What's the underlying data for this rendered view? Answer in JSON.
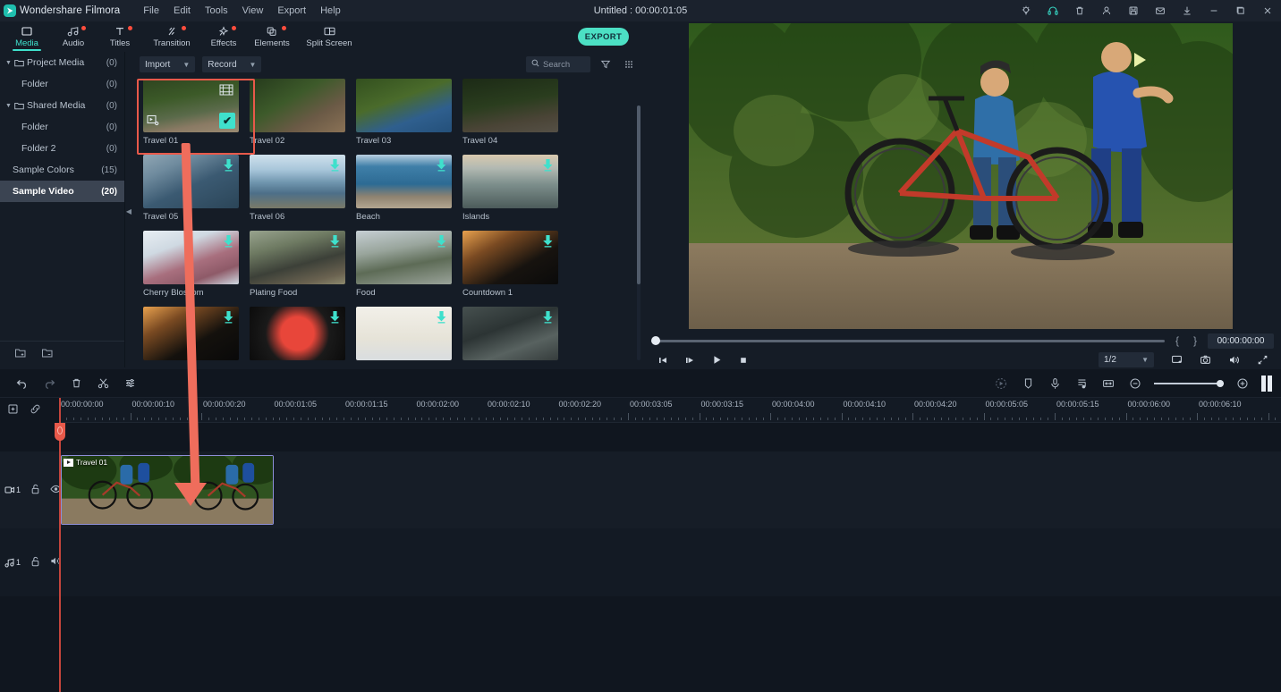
{
  "app": {
    "brand": "Wondershare Filmora",
    "document_title": "Untitled : 00:00:01:05",
    "accent_color": "#3fe0cc",
    "annotation_color": "#ef6d5c",
    "selection_color": "#e8594a"
  },
  "menu": {
    "items": [
      {
        "label": "File"
      },
      {
        "label": "Edit"
      },
      {
        "label": "Tools"
      },
      {
        "label": "View"
      },
      {
        "label": "Export"
      },
      {
        "label": "Help"
      }
    ]
  },
  "titlebar_icons": [
    {
      "name": "lightbulb-icon"
    },
    {
      "name": "headset-support-icon"
    },
    {
      "name": "trash-icon"
    },
    {
      "name": "account-icon"
    },
    {
      "name": "save-icon"
    },
    {
      "name": "mail-icon"
    },
    {
      "name": "download-icon"
    },
    {
      "name": "minimize-icon"
    },
    {
      "name": "maximize-icon"
    },
    {
      "name": "close-icon"
    }
  ],
  "tabs": [
    {
      "label": "Media",
      "icon": "media-icon",
      "active": true,
      "badge": false
    },
    {
      "label": "Audio",
      "icon": "audio-icon",
      "active": false,
      "badge": true
    },
    {
      "label": "Titles",
      "icon": "titles-icon",
      "active": false,
      "badge": true
    },
    {
      "label": "Transition",
      "icon": "transition-icon",
      "active": false,
      "badge": true
    },
    {
      "label": "Effects",
      "icon": "effects-icon",
      "active": false,
      "badge": true
    },
    {
      "label": "Elements",
      "icon": "elements-icon",
      "active": false,
      "badge": true
    },
    {
      "label": "Split Screen",
      "icon": "split-screen-icon",
      "active": false,
      "badge": false
    }
  ],
  "export_button": {
    "label": "EXPORT"
  },
  "sidebar": {
    "items": [
      {
        "label": "Project Media",
        "count": "(0)",
        "type": "folder-group",
        "expanded": true,
        "selected": false
      },
      {
        "label": "Folder",
        "count": "(0)",
        "type": "child",
        "selected": false
      },
      {
        "label": "Shared Media",
        "count": "(0)",
        "type": "folder-group",
        "expanded": true,
        "selected": false
      },
      {
        "label": "Folder",
        "count": "(0)",
        "type": "child",
        "selected": false
      },
      {
        "label": "Folder 2",
        "count": "(0)",
        "type": "child",
        "selected": false
      },
      {
        "label": "Sample Colors",
        "count": "(15)",
        "type": "plain",
        "selected": false
      },
      {
        "label": "Sample Video",
        "count": "(20)",
        "type": "plain",
        "selected": true
      }
    ],
    "footer_icons": [
      {
        "name": "add-folder-icon"
      },
      {
        "name": "remove-folder-icon"
      }
    ]
  },
  "media_toolbar": {
    "import_label": "Import",
    "record_label": "Record",
    "search_placeholder": "Search",
    "filter_icon": "filter-icon",
    "grid_view_icon": "grid-view-icon"
  },
  "media_items": [
    {
      "name": "Travel 01",
      "art": "a-forest",
      "selected": true,
      "badge": "check"
    },
    {
      "name": "Travel 02",
      "art": "a-trail",
      "selected": false,
      "badge": "none"
    },
    {
      "name": "Travel 03",
      "art": "a-portrait",
      "selected": false,
      "badge": "none"
    },
    {
      "name": "Travel 04",
      "art": "a-dark",
      "selected": false,
      "badge": "none"
    },
    {
      "name": "Travel 05",
      "art": "a-face",
      "selected": false,
      "badge": "download"
    },
    {
      "name": "Travel 06",
      "art": "a-lake",
      "selected": false,
      "badge": "download"
    },
    {
      "name": "Beach",
      "art": "a-beach",
      "selected": false,
      "badge": "download"
    },
    {
      "name": "Islands",
      "art": "a-island",
      "selected": false,
      "badge": "download"
    },
    {
      "name": "Cherry Blossom",
      "art": "a-cherry",
      "selected": false,
      "badge": "download"
    },
    {
      "name": "Plating Food",
      "art": "a-food1",
      "selected": false,
      "badge": "download"
    },
    {
      "name": "Food",
      "art": "a-food2",
      "selected": false,
      "badge": "download"
    },
    {
      "name": "Countdown 1",
      "art": "a-clap1",
      "selected": false,
      "badge": "download"
    },
    {
      "name": "",
      "art": "a-clap3",
      "selected": false,
      "badge": "download"
    },
    {
      "name": "",
      "art": "a-red1",
      "selected": false,
      "badge": "download"
    },
    {
      "name": "",
      "art": "a-white3",
      "selected": false,
      "badge": "download"
    },
    {
      "name": "",
      "art": "a-grey2",
      "selected": false,
      "badge": "download"
    }
  ],
  "preview": {
    "timecode": "00:00:00:00",
    "mark_in": "{",
    "mark_out": "}",
    "ratio": "1/2",
    "controls": [
      {
        "name": "previous-frame-button"
      },
      {
        "name": "next-frame-button"
      },
      {
        "name": "play-button"
      },
      {
        "name": "stop-button"
      }
    ],
    "right_icons": [
      {
        "name": "fullscreen-icon"
      },
      {
        "name": "snapshot-icon"
      },
      {
        "name": "volume-icon"
      },
      {
        "name": "expand-icon"
      }
    ]
  },
  "timeline": {
    "tools": [
      {
        "name": "undo-icon"
      },
      {
        "name": "redo-icon"
      },
      {
        "name": "delete-icon"
      },
      {
        "name": "split-icon"
      },
      {
        "name": "settings-icon"
      }
    ],
    "right_tools": [
      {
        "name": "render-preview-icon"
      },
      {
        "name": "marker-icon"
      },
      {
        "name": "voiceover-icon"
      },
      {
        "name": "audio-mixer-icon"
      },
      {
        "name": "fit-timeline-icon"
      },
      {
        "name": "zoom-out-icon"
      },
      {
        "name": "zoom-in-icon"
      }
    ],
    "header_icons": [
      {
        "name": "add-track-icon"
      },
      {
        "name": "link-icon"
      }
    ],
    "ruler_labels": [
      "00:00:00:00",
      "00:00:00:10",
      "00:00:00:20",
      "00:00:01:05",
      "00:00:01:15",
      "00:00:02:00",
      "00:00:02:10",
      "00:00:02:20",
      "00:00:03:05",
      "00:00:03:15",
      "00:00:04:00",
      "00:00:04:10",
      "00:00:04:20",
      "00:00:05:05",
      "00:00:05:15",
      "00:00:06:00",
      "00:00:06:10"
    ],
    "tracks": [
      {
        "id": "video-track-1",
        "label": "1",
        "type": "video",
        "icons": [
          "camera-icon",
          "unlock-icon",
          "eye-icon"
        ],
        "clip": {
          "label": "Travel 01"
        }
      },
      {
        "id": "audio-track-1",
        "label": "1",
        "type": "audio",
        "icons": [
          "music-note-icon",
          "unlock-icon",
          "speaker-icon"
        ],
        "clip": null
      }
    ]
  }
}
